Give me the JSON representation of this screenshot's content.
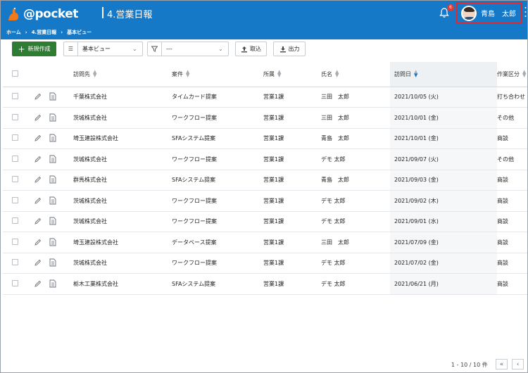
{
  "header": {
    "logo_text": "@pocket",
    "app_title": "4.営業日報",
    "breadcrumb": [
      "ホーム",
      "4.営業日報",
      "基本ビュー"
    ],
    "notification_count": "6",
    "user_name": "青島　太郎",
    "brand_color": "#1679c8"
  },
  "toolbar": {
    "new_label": "新規作成",
    "view_select": "基本ビュー",
    "filter_select": "---",
    "import_label": "取込",
    "export_label": "出力",
    "new_button_color": "#2e7d32"
  },
  "table": {
    "columns": [
      "訪問先",
      "案件",
      "所属",
      "氏名",
      "訪問日",
      "作業区分"
    ],
    "sorted_column": "訪問日",
    "rows": [
      {
        "client": "千葉株式会社",
        "project": "タイムカード提案",
        "dept": "営業1課",
        "name": "三田　太郎",
        "date": "2021/10/05 (火)",
        "type": "打ち合わせ"
      },
      {
        "client": "茨城株式会社",
        "project": "ワークフロー提案",
        "dept": "営業1課",
        "name": "三田　太郎",
        "date": "2021/10/01 (金)",
        "type": "その他"
      },
      {
        "client": "埼玉建設株式会社",
        "project": "SFAシステム提案",
        "dept": "営業1課",
        "name": "青島　太郎",
        "date": "2021/10/01 (金)",
        "type": "商談"
      },
      {
        "client": "茨城株式会社",
        "project": "ワークフロー提案",
        "dept": "営業1課",
        "name": "デモ 太郎",
        "date": "2021/09/07 (火)",
        "type": "その他"
      },
      {
        "client": "群馬株式会社",
        "project": "SFAシステム提案",
        "dept": "営業1課",
        "name": "青島　太郎",
        "date": "2021/09/03 (金)",
        "type": "商談"
      },
      {
        "client": "茨城株式会社",
        "project": "ワークフロー提案",
        "dept": "営業1課",
        "name": "デモ 太郎",
        "date": "2021/09/02 (木)",
        "type": "商談"
      },
      {
        "client": "茨城株式会社",
        "project": "ワークフロー提案",
        "dept": "営業1課",
        "name": "デモ 太郎",
        "date": "2021/09/01 (水)",
        "type": "商談"
      },
      {
        "client": "埼玉建設株式会社",
        "project": "データベース提案",
        "dept": "営業1課",
        "name": "三田　太郎",
        "date": "2021/07/09 (金)",
        "type": "商談"
      },
      {
        "client": "茨城株式会社",
        "project": "ワークフロー提案",
        "dept": "営業1課",
        "name": "デモ 太郎",
        "date": "2021/07/02 (金)",
        "type": "商談"
      },
      {
        "client": "栃木工業株式会社",
        "project": "SFAシステム提案",
        "dept": "営業1課",
        "name": "デモ 太郎",
        "date": "2021/06/21 (月)",
        "type": "商談"
      }
    ]
  },
  "footer": {
    "pager_text": "1 - 10 / 10 件"
  }
}
